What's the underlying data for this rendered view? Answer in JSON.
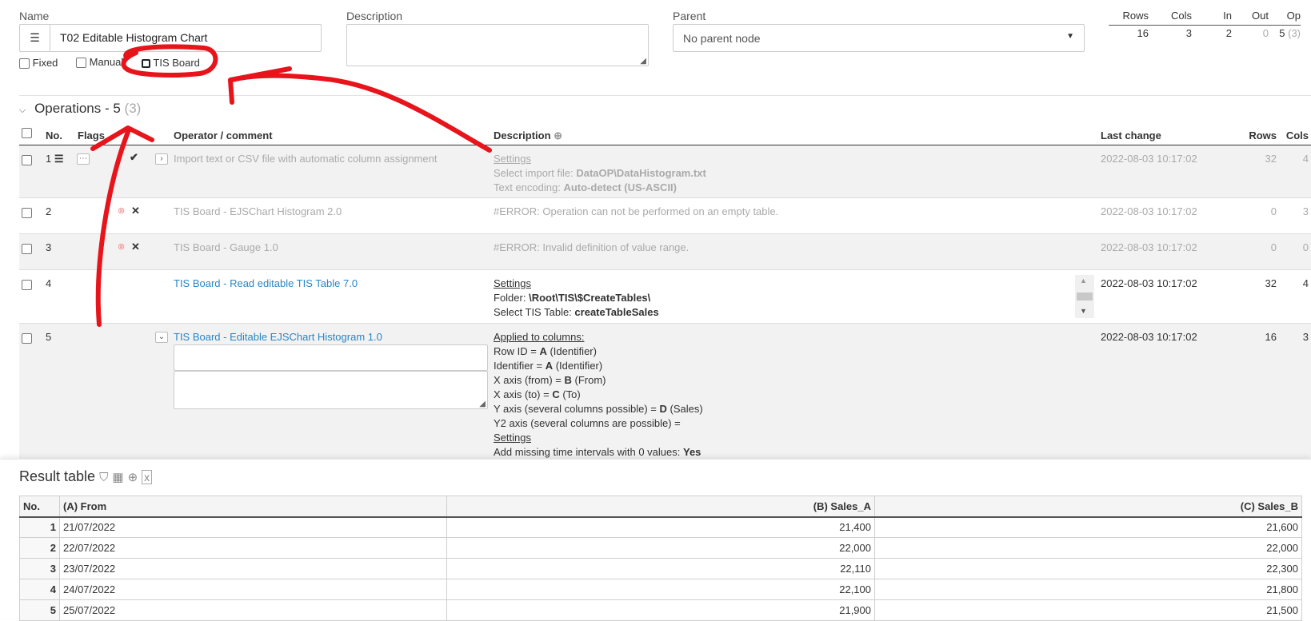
{
  "form": {
    "name_label": "Name",
    "name_value": "T02 Editable Histogram Chart",
    "description_label": "Description",
    "description_value": "",
    "parent_label": "Parent",
    "parent_value": "No parent node",
    "checkboxes": {
      "fixed": "Fixed",
      "manual": "Manual",
      "tis_board": "TIS Board"
    }
  },
  "stats": {
    "headers": [
      "Rows",
      "Cols",
      "In",
      "Out",
      "Op"
    ],
    "values": [
      "16",
      "3",
      "2",
      "0",
      "5"
    ],
    "op_extra": "(3)"
  },
  "operations": {
    "title": "Operations - 5",
    "title_count": "(3)",
    "columns": {
      "no": "No.",
      "flags": "Flags",
      "operator": "Operator / comment",
      "description": "Description",
      "last_change": "Last change",
      "rows": "Rows",
      "cols": "Cols"
    },
    "rows": [
      {
        "no": "1",
        "operator": "Import text or CSV file with automatic column assignment",
        "desc": [
          "Settings",
          "Select import file: ",
          "DataOP\\DataHistogram.txt",
          "Text encoding: ",
          "Auto-detect (US-ASCII)"
        ],
        "last_change": "2022-08-03 10:17:02",
        "rows": "32",
        "cols": "4"
      },
      {
        "no": "2",
        "operator": "TIS Board - EJSChart Histogram 2.0",
        "desc": [
          "#ERROR: Operation can not be performed on an empty table."
        ],
        "last_change": "2022-08-03 10:17:02",
        "rows": "0",
        "cols": "3"
      },
      {
        "no": "3",
        "operator": "TIS Board - Gauge 1.0",
        "desc": [
          "#ERROR: Invalid definition of value range."
        ],
        "last_change": "2022-08-03 10:17:02",
        "rows": "0",
        "cols": "0"
      },
      {
        "no": "4",
        "operator": "TIS Board - Read editable TIS Table 7.0",
        "desc": [
          "Settings",
          "Folder: ",
          "\\Root\\TIS\\$CreateTables\\",
          "Select TIS Table: ",
          "createTableSales"
        ],
        "last_change": "2022-08-03 10:17:02",
        "rows": "32",
        "cols": "4"
      },
      {
        "no": "5",
        "operator": "TIS Board - Editable EJSChart Histogram 1.0",
        "desc": [
          "Applied to columns:",
          "Row ID = ",
          "A",
          " (Identifier)",
          "Identifier = ",
          "A",
          " (Identifier)",
          "X axis (from) = ",
          "B",
          " (From)",
          "X axis (to) = ",
          "C",
          " (To)",
          "Y axis (several columns possible) = ",
          "D",
          " (Sales)",
          "Y2 axis (several columns are possible) =",
          "Settings",
          "Add missing time intervals with 0 values: ",
          "Yes"
        ],
        "last_change": "2022-08-03 10:17:02",
        "rows": "16",
        "cols": "3"
      }
    ]
  },
  "result": {
    "title": "Result table",
    "columns": [
      "No.",
      "(A) From",
      "(B) Sales_A",
      "(C) Sales_B"
    ],
    "rows": [
      [
        "1",
        "21/07/2022",
        "21,400",
        "21,600"
      ],
      [
        "2",
        "22/07/2022",
        "22,000",
        "22,000"
      ],
      [
        "3",
        "23/07/2022",
        "22,110",
        "22,300"
      ],
      [
        "4",
        "24/07/2022",
        "22,100",
        "21,800"
      ],
      [
        "5",
        "25/07/2022",
        "21,900",
        "21,500"
      ]
    ]
  },
  "colors": {
    "annotation": "#e8141b",
    "link": "#2a86c4",
    "muted": "#aaaaaa"
  }
}
